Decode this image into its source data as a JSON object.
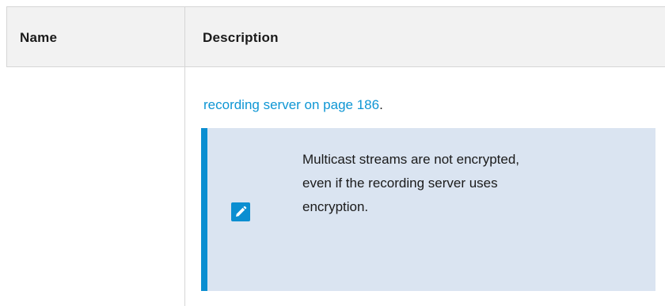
{
  "table": {
    "headers": {
      "name": "Name",
      "description": "Description"
    },
    "row": {
      "name": "",
      "description_link": "recording server on page 186",
      "description_suffix": "."
    }
  },
  "note": {
    "icon": "pencil-icon",
    "text": "Multicast streams are not encrypted, even if the recording server uses encryption."
  },
  "colors": {
    "link": "#0e96d4",
    "note_background": "#dae4f1",
    "note_accent": "#0b8ed1",
    "header_background": "#f2f2f2"
  }
}
